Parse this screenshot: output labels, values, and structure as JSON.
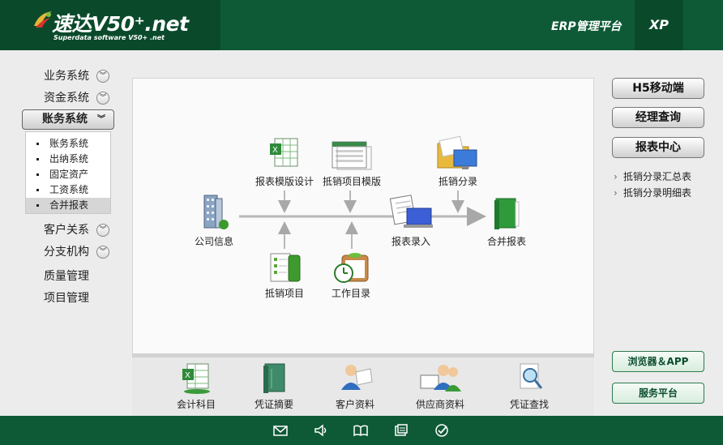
{
  "header": {
    "logo_text": "速达V50⁺.net",
    "logo_subtitle": "Superdata software V50+ .net",
    "platform_title": "ERP管理平台",
    "edition": "XP"
  },
  "nav": {
    "items_top": [
      {
        "label": "业务系统"
      },
      {
        "label": "资金系统"
      }
    ],
    "active": {
      "label": "账务系统"
    },
    "submenu": [
      {
        "label": "账务系统"
      },
      {
        "label": "出纳系统"
      },
      {
        "label": "固定资产"
      },
      {
        "label": "工资系统"
      },
      {
        "label": "合并报表",
        "selected": true
      }
    ],
    "items_bottom": [
      {
        "label": "客户关系"
      },
      {
        "label": "分支机构"
      }
    ],
    "plain_items": [
      {
        "label": "质量管理"
      },
      {
        "label": "项目管理"
      }
    ]
  },
  "flow": {
    "company_info": "公司信息",
    "template_design": "报表模版设计",
    "item_template": "抵销项目模版",
    "elim_entry": "抵销分录",
    "report_entry": "报表录入",
    "consolidated": "合并报表",
    "elim_items": "抵销项目",
    "work_dir": "工作目录"
  },
  "shortcuts": [
    {
      "label": "会计科目",
      "icon": "spreadsheet-icon"
    },
    {
      "label": "凭证摘要",
      "icon": "book-icon"
    },
    {
      "label": "客户资料",
      "icon": "customer-icon"
    },
    {
      "label": "供应商资料",
      "icon": "supplier-icon"
    },
    {
      "label": "凭证查找",
      "icon": "search-icon"
    }
  ],
  "right_panel": {
    "h5": "H5移动端",
    "manager": "经理查询",
    "report_center": "报表中心",
    "links": [
      "抵销分录汇总表",
      "抵销分录明细表"
    ],
    "browser_app": "浏览器＆APP",
    "service": "服务平台"
  },
  "footer_icons": [
    "mail-icon",
    "volume-icon",
    "book-open-icon",
    "window-icon",
    "check-circle-icon"
  ],
  "colors": {
    "header": "#0e5a36",
    "header_dark": "#0a4a2b"
  }
}
